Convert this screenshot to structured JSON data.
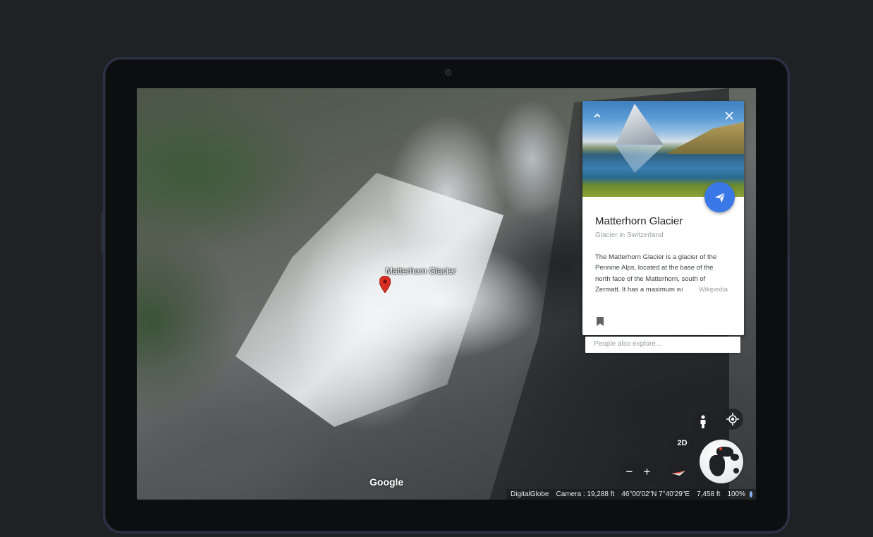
{
  "map": {
    "place_label": "Matterhorn Glacier",
    "brand": "Google",
    "pin_color": "#d93025"
  },
  "card": {
    "title": "Matterhorn Glacier",
    "subtitle": "Glacier in Switzerland",
    "description": "The Matterhorn Glacier is a glacier of the Pennine Alps, located at the base of the north face of the Matterhorn, south of Zermatt. It has a maximum wi",
    "source": "Wikipedia",
    "collapse_icon": "chevron-up-icon",
    "close_icon": "close-icon",
    "share_icon": "paper-plane-icon",
    "bookmark_icon": "bookmark-icon",
    "accent_color": "#3b78e7"
  },
  "explore": {
    "placeholder": "People also explore..."
  },
  "controls": {
    "pegman_icon": "pegman-icon",
    "locate_icon": "my-location-icon",
    "view_toggle": "2D",
    "compass_icon": "compass-icon",
    "zoom_out": "−",
    "zoom_in": "+",
    "globe_icon": "globe-icon"
  },
  "status": {
    "attribution": "DigitalGlobe",
    "camera": "Camera : 19,288 ft",
    "coordinates": "46°00'02\"N 7°40'29\"E",
    "elevation": "7,458 ft",
    "zoom": "100%"
  }
}
